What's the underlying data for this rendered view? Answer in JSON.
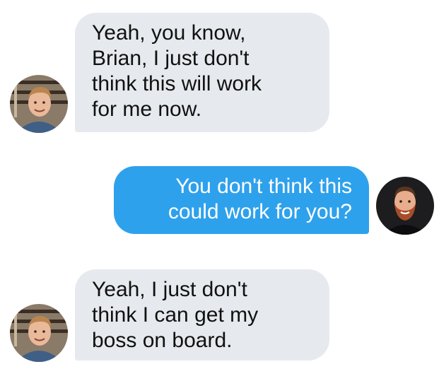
{
  "conversation": {
    "messages": [
      {
        "sender": "contact",
        "lines": [
          "Yeah, you know,",
          "Brian, I just don't",
          "think this will work",
          "for me now."
        ]
      },
      {
        "sender": "self",
        "lines": [
          "You don't think this",
          "could work for you?"
        ]
      },
      {
        "sender": "contact",
        "lines": [
          "Yeah, I just don't",
          "think I can get my",
          "boss on board."
        ]
      }
    ]
  },
  "colors": {
    "incoming_bubble": "#e6e9ed",
    "outgoing_bubble": "#2ea1ec",
    "incoming_text": "#111111",
    "outgoing_text": "#ffffff"
  },
  "icons": {
    "contact_avatar": "contact-avatar-photo",
    "self_avatar": "self-avatar-photo"
  }
}
